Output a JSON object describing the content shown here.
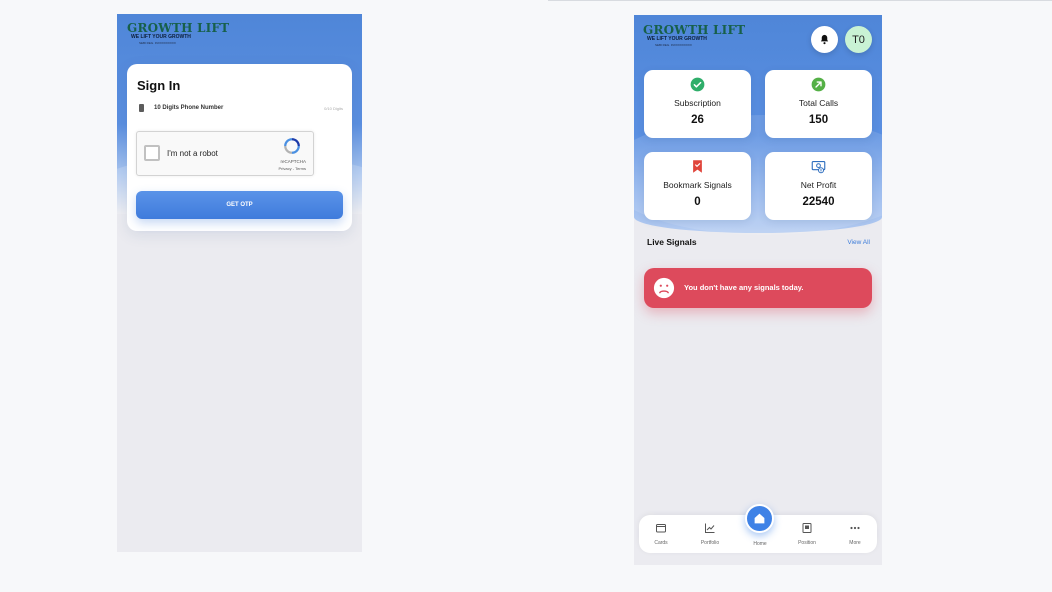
{
  "signin_screen": {
    "logo": {
      "brand": "GROWTH LIFT",
      "tagline": "WE LIFT YOUR GROWTH",
      "subline": "SEBI REG. INXXXXXXXXX"
    },
    "title": "Sign In",
    "phone_field": {
      "placeholder": "10 Digits Phone Number",
      "counter": "0/10 Digits"
    },
    "recaptcha": {
      "label": "I'm not a robot",
      "brand": "reCAPTCHA",
      "links": "Privacy - Terms"
    },
    "otp_button": "GET OTP"
  },
  "home_screen": {
    "logo": {
      "brand": "GROWTH LIFT",
      "tagline": "WE LIFT YOUR GROWTH",
      "subline": "SEBI REG. INXXXXXXXXX"
    },
    "avatar_initials": "T0",
    "stats": [
      {
        "label": "Subscription",
        "value": "26",
        "icon": "check-circle-icon",
        "color": "#2fae6a"
      },
      {
        "label": "Total Calls",
        "value": "150",
        "icon": "arrow-up-right-icon",
        "color": "#54b046"
      },
      {
        "label": "Bookmark Signals",
        "value": "0",
        "icon": "bookmark-icon",
        "color": "#e0453b"
      },
      {
        "label": "Net Profit",
        "value": "22540",
        "icon": "money-icon",
        "color": "#2f6fbf"
      }
    ],
    "live_signals": {
      "title": "Live Signals",
      "view_all": "View All"
    },
    "alert": {
      "text": "You don't have any signals today.",
      "color": "#dd4a5c"
    },
    "nav": {
      "items": [
        "Cards",
        "Portfolio",
        "Home",
        "Position",
        "More"
      ],
      "active": "Home"
    }
  },
  "colors": {
    "primary": "#4f86d8",
    "accent": "#3f82e6",
    "logo_green": "#17604a"
  }
}
